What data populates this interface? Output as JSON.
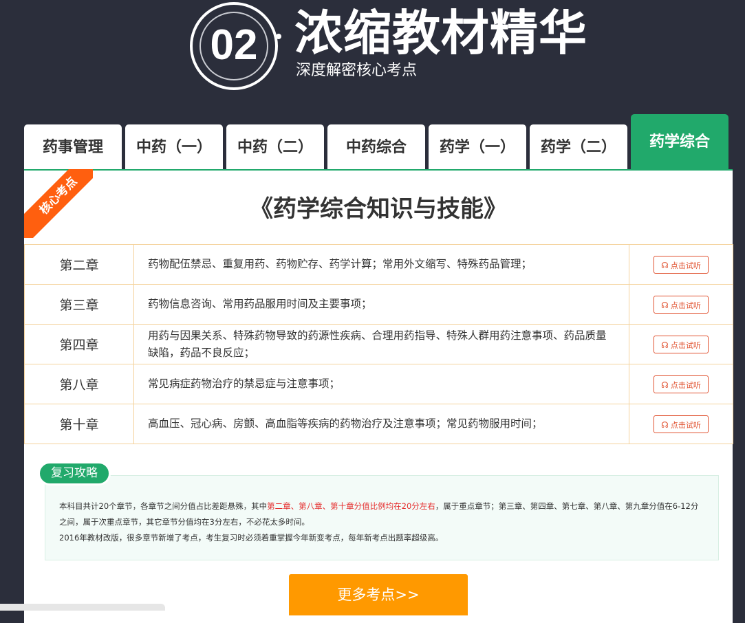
{
  "header": {
    "number": "02",
    "title": "浓缩教材精华",
    "subtitle": "深度解密核心考点"
  },
  "tabs": [
    {
      "label": "药事管理"
    },
    {
      "label": "中药（一）"
    },
    {
      "label": "中药（二）"
    },
    {
      "label": "中药综合"
    },
    {
      "label": "药学（一）"
    },
    {
      "label": "药学（二）"
    },
    {
      "label": "药学综合",
      "active": true
    }
  ],
  "panel": {
    "ribbon": "核心考点",
    "book_title": "《药学综合知识与技能》",
    "listen_label": "点击试听",
    "listen_icon": "headphone-icon",
    "chapters": [
      {
        "chapter": "第二章",
        "desc": "药物配伍禁忌、重复用药、药物贮存、药学计算；常用外文缩写、特殊药品管理；"
      },
      {
        "chapter": "第三章",
        "desc": "药物信息咨询、常用药品服用时间及主要事项；"
      },
      {
        "chapter": "第四章",
        "desc": "用药与因果关系、特殊药物导致的药源性疾病、合理用药指导、特殊人群用药注意事项、药品质量缺陷，药品不良反应；"
      },
      {
        "chapter": "第八章",
        "desc": "常见病症药物治疗的禁忌症与注意事项；"
      },
      {
        "chapter": "第十章",
        "desc": "高血压、冠心病、房颤、高血脂等疾病的药物治疗及注意事项；常见药物服用时间；"
      }
    ]
  },
  "review": {
    "tag": "复习攻略",
    "line1_a": "本科目共计20个章节，各章节之间分值占比差距悬殊，其中",
    "line1_highlight": "第二章、第八章、第十章分值比例均在20分左右",
    "line1_b": "，属于重点章节；第三章、第四章、第七章、第八章、第九章分值在6-12分之间，属于次重点章节，其它章节分值均在3分左右，不必花太多时间。",
    "line2": "2016年教材改版，很多章节新增了考点，考生复习时必须着重掌握今年新变考点，每年新考点出题率超级高。"
  },
  "more_button": "更多考点>>",
  "colors": {
    "background": "#2b2e3b",
    "accent_green": "#21a96b",
    "ribbon_orange": "#ff5f0f",
    "button_orange": "#ff9900",
    "highlight_red": "#e52d2d",
    "table_border": "#f4d29b"
  }
}
